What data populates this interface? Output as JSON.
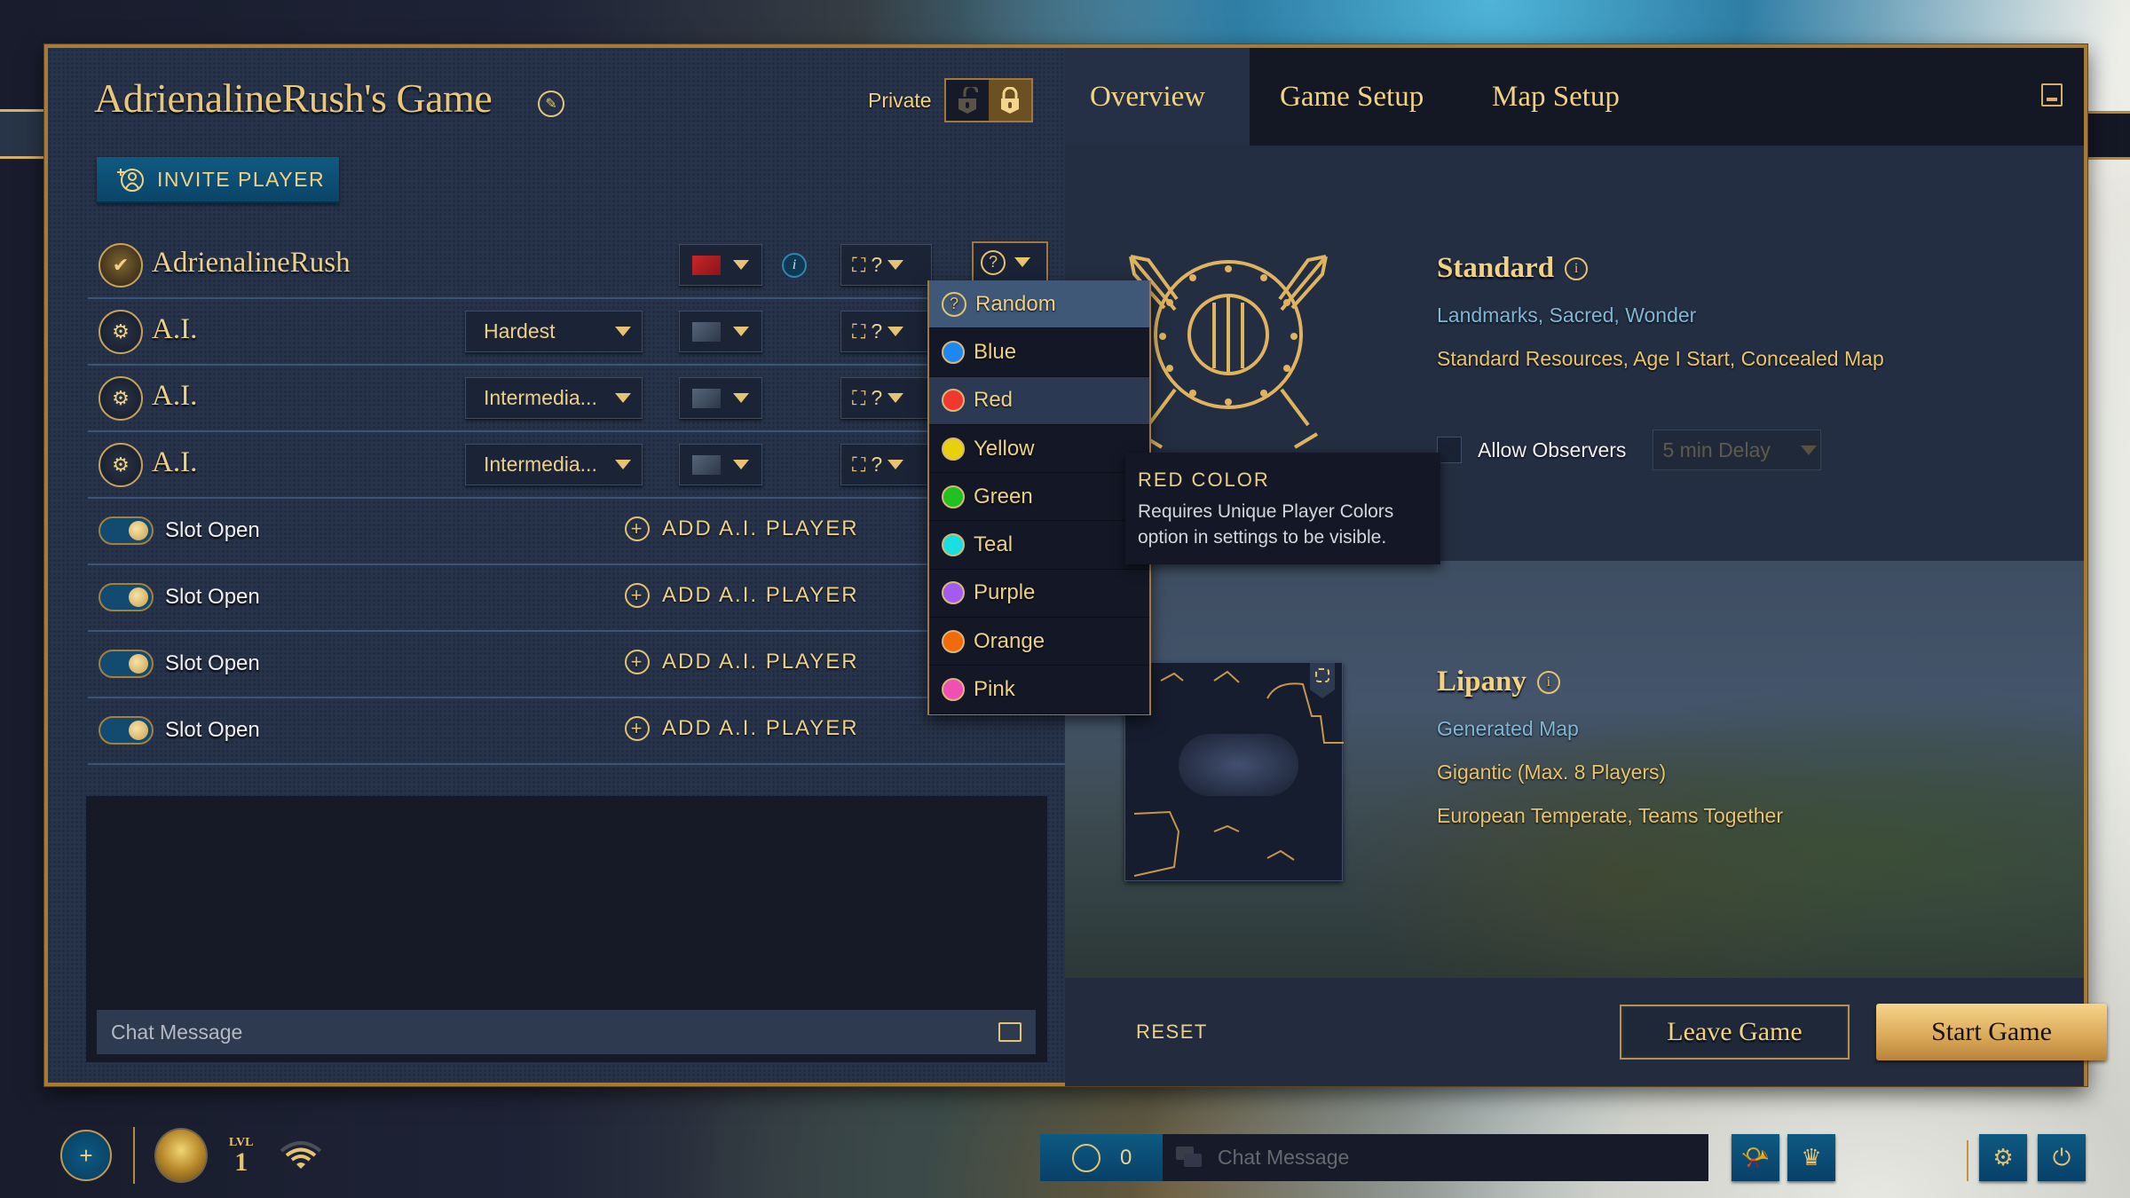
{
  "lobby": {
    "title": "AdrienalineRush's Game",
    "privacy_label": "Private",
    "privacy_state": "private",
    "invite_label": "INVITE PLAYER"
  },
  "players": [
    {
      "name": "AdrienalineRush",
      "type": "human",
      "difficulty": null,
      "civ": "red-flag",
      "team": "?",
      "color": "Random"
    },
    {
      "name": "A.I.",
      "type": "ai",
      "difficulty": "Hardest",
      "civ": "random",
      "team": "?",
      "color": null
    },
    {
      "name": "A.I.",
      "type": "ai",
      "difficulty": "Intermedia...",
      "civ": "random",
      "team": "?",
      "color": null
    },
    {
      "name": "A.I.",
      "type": "ai",
      "difficulty": "Intermedia...",
      "civ": "random",
      "team": "?",
      "color": null
    }
  ],
  "open_slots": [
    {
      "label": "Slot Open",
      "action": "ADD A.I. PLAYER"
    },
    {
      "label": "Slot Open",
      "action": "ADD A.I. PLAYER"
    },
    {
      "label": "Slot Open",
      "action": "ADD A.I. PLAYER"
    },
    {
      "label": "Slot Open",
      "action": "ADD A.I. PLAYER"
    }
  ],
  "chat": {
    "placeholder": "Chat Message",
    "value": ""
  },
  "color_menu": {
    "selected": "Random",
    "hovered": "Red",
    "options": [
      {
        "label": "Random",
        "color": null
      },
      {
        "label": "Blue",
        "color": "#1e88f0"
      },
      {
        "label": "Red",
        "color": "#f2372f"
      },
      {
        "label": "Yellow",
        "color": "#e8d00a"
      },
      {
        "label": "Green",
        "color": "#1fc21f"
      },
      {
        "label": "Teal",
        "color": "#18e0e0"
      },
      {
        "label": "Purple",
        "color": "#a45cf0"
      },
      {
        "label": "Orange",
        "color": "#f26a0a"
      },
      {
        "label": "Pink",
        "color": "#f050b4"
      }
    ]
  },
  "tooltip": {
    "title": "RED COLOR",
    "body": "Requires Unique Player Colors option in settings to be visible."
  },
  "tabs": [
    {
      "label": "Overview",
      "active": true
    },
    {
      "label": "Game Setup",
      "active": false
    },
    {
      "label": "Map Setup",
      "active": false
    }
  ],
  "game_mode": {
    "name": "Standard",
    "win_conditions": "Landmarks, Sacred, Wonder",
    "settings": "Standard Resources, Age I Start, Concealed Map",
    "allow_observers_label": "Allow Observers",
    "allow_observers": false,
    "observer_delay": "5 min Delay"
  },
  "map": {
    "name": "Lipany",
    "type": "Generated Map",
    "size": "Gigantic (Max. 8 Players)",
    "details": "European Temperate, Teams Together"
  },
  "actions": {
    "reset": "RESET",
    "leave": "Leave Game",
    "start": "Start Game"
  },
  "taskbar": {
    "level_label": "LVL",
    "level": "1",
    "friends_online": "0",
    "chat_placeholder": "Chat Message"
  },
  "colors": {
    "gold": "#f1d285",
    "accent_blue": "#0e5a82",
    "panel": "#27334a",
    "frame": "#a87b35"
  }
}
